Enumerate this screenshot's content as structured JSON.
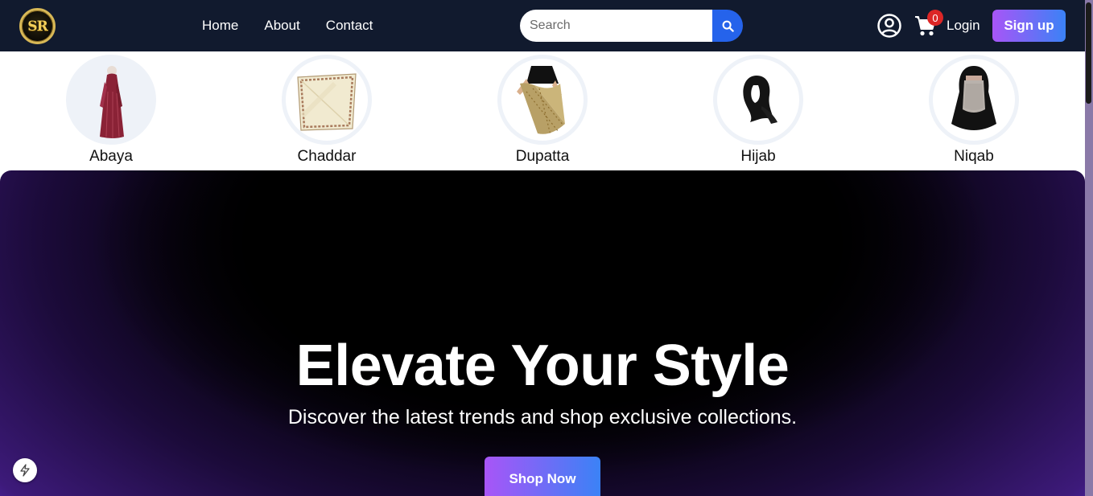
{
  "brand": {
    "logo_text": "SR"
  },
  "nav": {
    "links": [
      "Home",
      "About",
      "Contact"
    ]
  },
  "search": {
    "placeholder": "Search"
  },
  "header": {
    "cart_count": "0",
    "login_label": "Login",
    "signup_label": "Sign up"
  },
  "categories": [
    "Abaya",
    "Chaddar",
    "Dupatta",
    "Hijab",
    "Niqab"
  ],
  "hero": {
    "title": "Elevate Your Style",
    "subtitle": "Discover the latest trends and shop exclusive collections.",
    "cta_label": "Shop Now"
  },
  "colors": {
    "navbar": "#111a2e",
    "search_button": "#2563eb",
    "cart_badge": "#dc2626",
    "gradient_start": "#a855f7",
    "gradient_end": "#3b82f6",
    "hero_glow": "#4a22a0"
  },
  "icons": [
    "search-icon",
    "user-circle-icon",
    "cart-icon",
    "lightning-icon"
  ]
}
